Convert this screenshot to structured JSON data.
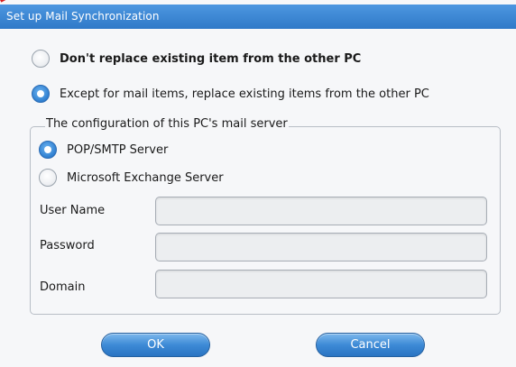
{
  "window": {
    "title": "Set up Mail Synchronization"
  },
  "options": {
    "dont_replace": {
      "label": "Don't replace existing item from the other PC",
      "selected": false
    },
    "replace_except_mail": {
      "label": "Except for mail items, replace existing items from the other PC",
      "selected": true
    }
  },
  "server_config": {
    "legend": "The configuration of this PC's mail server",
    "pop_smtp": {
      "label": "POP/SMTP Server",
      "selected": true
    },
    "exchange": {
      "label": "Microsoft Exchange Server",
      "selected": false
    },
    "user_name": {
      "label": "User Name",
      "value": ""
    },
    "password": {
      "label": "Password",
      "value": ""
    },
    "domain": {
      "label": "Domain",
      "value": ""
    }
  },
  "buttons": {
    "ok": "OK",
    "cancel": "Cancel"
  }
}
